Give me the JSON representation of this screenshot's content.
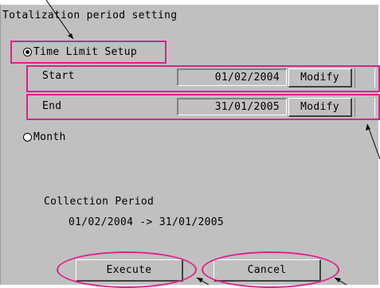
{
  "title": "Totalization period setting",
  "options": {
    "time_limit": "Time Limit Setup",
    "month": "Month"
  },
  "start": {
    "label": "Start",
    "date": "01/02/2004",
    "modify": "Modify"
  },
  "end": {
    "label": "End",
    "date": "31/01/2005",
    "modify": "Modify"
  },
  "collection": {
    "heading": "Collection Period",
    "range": "01/02/2004 -> 31/01/2005"
  },
  "buttons": {
    "execute": "Execute",
    "cancel": "Cancel"
  },
  "colors": {
    "highlight": "#e0208a",
    "panel": "#c0c0c0"
  }
}
